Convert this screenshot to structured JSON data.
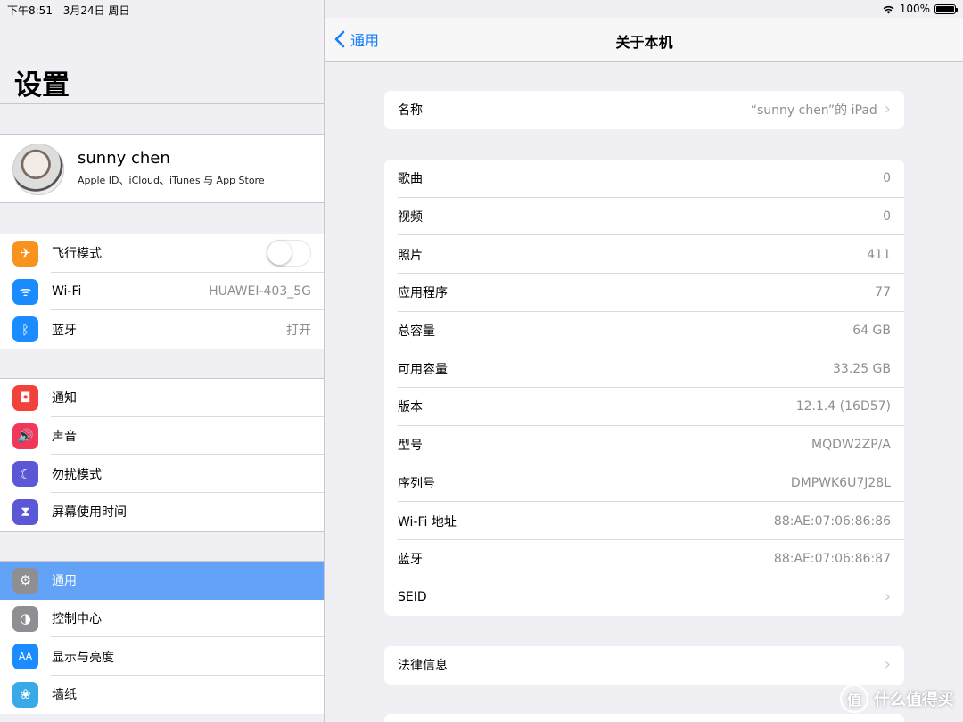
{
  "status_bar": {
    "time": "下午8:51",
    "date": "3月24日 周日",
    "battery": "100%",
    "battery_level": 1.0
  },
  "sidebar": {
    "title": "设置",
    "profile": {
      "name": "sunny chen",
      "subtitle": "Apple ID、iCloud、iTunes 与 App Store"
    },
    "group1": [
      {
        "label": "飞行模式",
        "value": "",
        "icon": "airplane-icon",
        "color": "#f7931e",
        "glyph": "✈",
        "toggle": true,
        "toggle_on": false
      },
      {
        "label": "Wi-Fi",
        "value": "HUAWEI-403_5G",
        "icon": "wifi-icon",
        "color": "#1a8cff",
        "glyph": "ᯤ"
      },
      {
        "label": "蓝牙",
        "value": "打开",
        "icon": "bluetooth-icon",
        "color": "#1a8cff",
        "glyph": "ᛒ"
      }
    ],
    "group2": [
      {
        "label": "通知",
        "icon": "notification-icon",
        "color": "#f2403a",
        "glyph": "◘"
      },
      {
        "label": "声音",
        "icon": "sound-icon",
        "color": "#f2385a",
        "glyph": "🔊"
      },
      {
        "label": "勿扰模式",
        "icon": "moon-icon",
        "color": "#5b57d6",
        "glyph": "☾"
      },
      {
        "label": "屏幕使用时间",
        "icon": "hourglass-icon",
        "color": "#5b57d6",
        "glyph": "⧗"
      }
    ],
    "group3": [
      {
        "label": "通用",
        "icon": "gear-icon",
        "color": "#8e8e93",
        "glyph": "⚙",
        "selected": true
      },
      {
        "label": "控制中心",
        "icon": "control-center-icon",
        "color": "#8e8e93",
        "glyph": "◑"
      },
      {
        "label": "显示与亮度",
        "icon": "display-icon",
        "color": "#1a8cff",
        "glyph": "AA"
      },
      {
        "label": "墙纸",
        "icon": "wallpaper-icon",
        "color": "#3aa9e8",
        "glyph": "❀"
      }
    ]
  },
  "detail": {
    "back_label": "通用",
    "title": "关于本机",
    "name_row": {
      "label": "名称",
      "value": "“sunny chen”的 iPad"
    },
    "info_rows": [
      {
        "label": "歌曲",
        "value": "0"
      },
      {
        "label": "视频",
        "value": "0"
      },
      {
        "label": "照片",
        "value": "411"
      },
      {
        "label": "应用程序",
        "value": "77"
      },
      {
        "label": "总容量",
        "value": "64 GB"
      },
      {
        "label": "可用容量",
        "value": "33.25 GB"
      },
      {
        "label": "版本",
        "value": "12.1.4 (16D57)"
      },
      {
        "label": "型号",
        "value": "MQDW2ZP/A"
      },
      {
        "label": "序列号",
        "value": "DMPWK6U7J28L"
      },
      {
        "label": "Wi-Fi 地址",
        "value": "88:AE:07:06:86:86"
      },
      {
        "label": "蓝牙",
        "value": "88:AE:07:06:86:87"
      },
      {
        "label": "SEID",
        "value": "",
        "chevron": true
      }
    ],
    "legal_row": {
      "label": "法律信息"
    }
  },
  "watermark": {
    "logo": "值",
    "text": "什么值得买"
  }
}
